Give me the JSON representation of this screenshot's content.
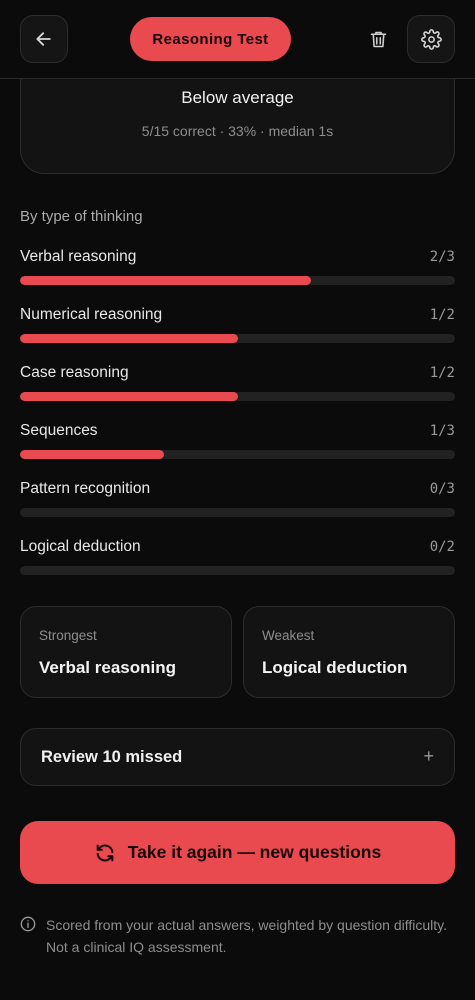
{
  "header": {
    "title": "Reasoning Test",
    "back_icon": "arrow-left-icon",
    "trash_icon": "trash-icon",
    "settings_icon": "gear-icon"
  },
  "summary": {
    "rating": "Below average",
    "details": "5/15 correct · 33% · median 1s"
  },
  "breakdown": {
    "title": "By type of thinking",
    "categories": [
      {
        "label": "Verbal reasoning",
        "score": "2/3",
        "fraction": 0.67
      },
      {
        "label": "Numerical reasoning",
        "score": "1/2",
        "fraction": 0.5
      },
      {
        "label": "Case reasoning",
        "score": "1/2",
        "fraction": 0.5
      },
      {
        "label": "Sequences",
        "score": "1/3",
        "fraction": 0.33
      },
      {
        "label": "Pattern recognition",
        "score": "0/3",
        "fraction": 0.0
      },
      {
        "label": "Logical deduction",
        "score": "0/2",
        "fraction": 0.0
      }
    ]
  },
  "highlights": {
    "strongest_label": "Strongest",
    "strongest_value": "Verbal reasoning",
    "weakest_label": "Weakest",
    "weakest_value": "Logical deduction"
  },
  "review": {
    "label": "Review 10 missed",
    "toggle": "+"
  },
  "cta": {
    "label": "Take it again — new questions",
    "icon": "refresh-icon"
  },
  "footnote": {
    "text": "Scored from your actual answers, weighted by question difficulty. Not a clinical IQ assessment.",
    "icon": "info-icon"
  },
  "colors": {
    "accent": "#e84a4f",
    "background": "#0b0b0b",
    "card": "#131313",
    "track": "#222222"
  }
}
